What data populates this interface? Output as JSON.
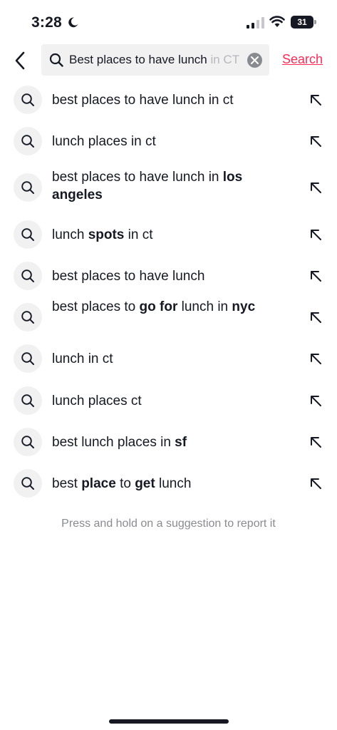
{
  "status_bar": {
    "time": "3:28",
    "battery": "31"
  },
  "search": {
    "query": "Best places to have lunch ",
    "query_faded": "in CT",
    "search_label": "Search"
  },
  "suggestions": [
    {
      "parts": [
        {
          "t": "best places to have lunch in ct",
          "b": false
        }
      ]
    },
    {
      "parts": [
        {
          "t": "lunch places in ct",
          "b": false
        }
      ]
    },
    {
      "parts": [
        {
          "t": "best places to have lunch in ",
          "b": false
        },
        {
          "t": "los angeles",
          "b": true
        }
      ]
    },
    {
      "parts": [
        {
          "t": "lunch ",
          "b": false
        },
        {
          "t": "spots",
          "b": true
        },
        {
          "t": " in ct",
          "b": false
        }
      ]
    },
    {
      "parts": [
        {
          "t": "best places to have lunch",
          "b": false
        }
      ]
    },
    {
      "parts": [
        {
          "t": "best places to ",
          "b": false
        },
        {
          "t": "go for",
          "b": true
        },
        {
          "t": " lunch in ",
          "b": false
        },
        {
          "t": "nyc",
          "b": true
        }
      ]
    },
    {
      "parts": [
        {
          "t": "lunch in ct",
          "b": false
        }
      ]
    },
    {
      "parts": [
        {
          "t": "lunch places ct",
          "b": false
        }
      ]
    },
    {
      "parts": [
        {
          "t": "best lunch places in ",
          "b": false
        },
        {
          "t": "sf",
          "b": true
        }
      ]
    },
    {
      "parts": [
        {
          "t": "best ",
          "b": false
        },
        {
          "t": "place",
          "b": true
        },
        {
          "t": " to ",
          "b": false
        },
        {
          "t": "get",
          "b": true
        },
        {
          "t": " lunch",
          "b": false
        }
      ]
    }
  ],
  "hint": "Press and hold on a suggestion to report it",
  "colors": {
    "accent": "#fe2c55",
    "text": "#161823",
    "muted": "#8a8b91",
    "chip_bg": "#f1f1f2"
  }
}
